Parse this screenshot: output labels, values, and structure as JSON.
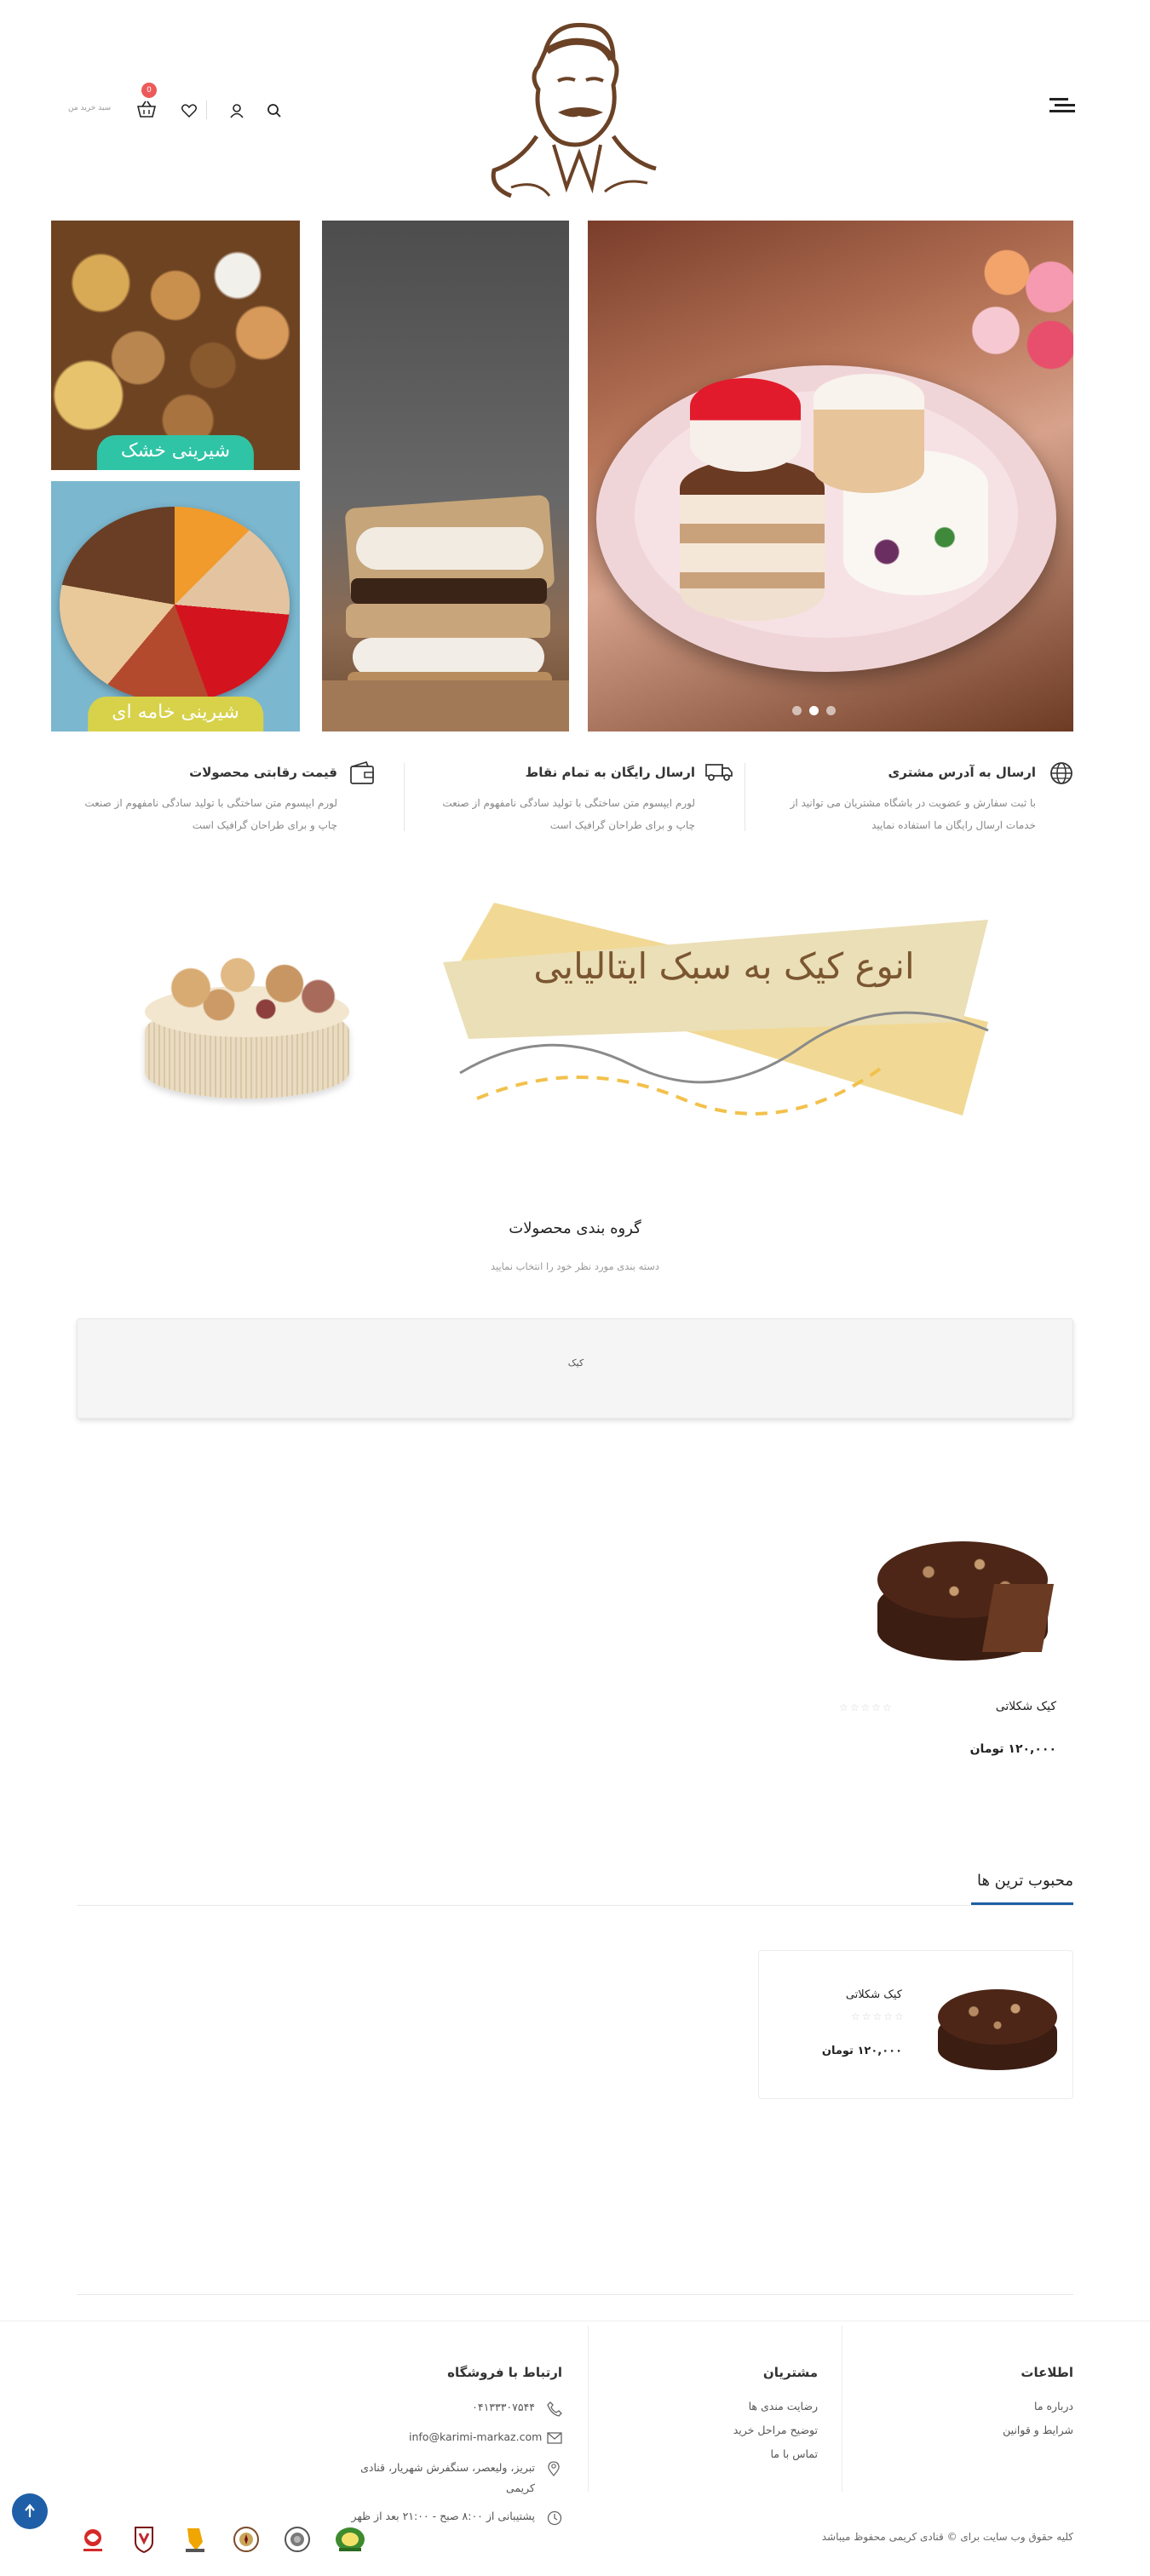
{
  "header": {
    "cart_label": "سبد خرید من",
    "cart_count": "0",
    "logo_alt": "قنادی کریمی"
  },
  "banners": {
    "label_1": "شیرینی خشک",
    "label_2": "شیرینی خامه ای"
  },
  "features": [
    {
      "title": "ارسال به آدرس مشتری",
      "desc": "با ثبت سفارش و عضویت در باشگاه مشتریان می توانید از خدمات ارسال رایگان ما استفاده نمایید",
      "icon": "globe-icon"
    },
    {
      "title": "ارسال رایگان به تمام نقاط",
      "desc": "لورم ایپسوم متن ساختگی با تولید سادگی نامفهوم از صنعت چاپ و برای طراحان گرافیک است",
      "icon": "truck-icon"
    },
    {
      "title": "قیمت رقابتی محصولات",
      "desc": "لورم ایپسوم متن ساختگی با تولید سادگی نامفهوم از صنعت چاپ و برای طراحان گرافیک است",
      "icon": "wallet-icon"
    }
  ],
  "promo": {
    "headline": "انوع کیک به سبک ایتالیایی"
  },
  "categories": {
    "title": "گروه بندی محصولات",
    "subtitle": "دسته بندی مورد نظر خود را انتخاب نمایید",
    "items": [
      "کیک"
    ]
  },
  "product": {
    "name": "کیک شکلاتی",
    "price": "۱۲۰,۰۰۰ تومان"
  },
  "popular": {
    "title": "محبوب ترین ها",
    "product_name": "کیک شکلاتی",
    "product_price": "۱۲۰,۰۰۰ تومان"
  },
  "footer": {
    "info_title": "اطلاعات",
    "info_links": [
      "درباره ما",
      "شرایط و قوانین"
    ],
    "customers_title": "مشتریان",
    "customers_links": [
      "رضایت مندی ها",
      "توضیح مراحل خرید",
      "تماس با ما"
    ],
    "contact_title": "ارتباط با فروشگاه",
    "phone": "۰۴۱۳۳۳۰۷۵۴۴",
    "email": "info@karimi-markaz.com",
    "address_line1": "تبریز، ولیعصر، سنگفرش شهریار، قنادی",
    "address_line2": "کریمی",
    "hours": "پشتیبانی از ۸:۰۰ صبح - ۲۱:۰۰ بعد از ظهر",
    "copyright": "کلیه حقوق وب سایت برای © قنادی کریمی محفوظ میباشد"
  },
  "colors": {
    "accent_blue": "#1e5fa8",
    "badge_red": "#ec5a5a",
    "label_teal": "#2fc4a6",
    "label_yellow": "#d7d24a",
    "logo_brown": "#6b4226"
  }
}
